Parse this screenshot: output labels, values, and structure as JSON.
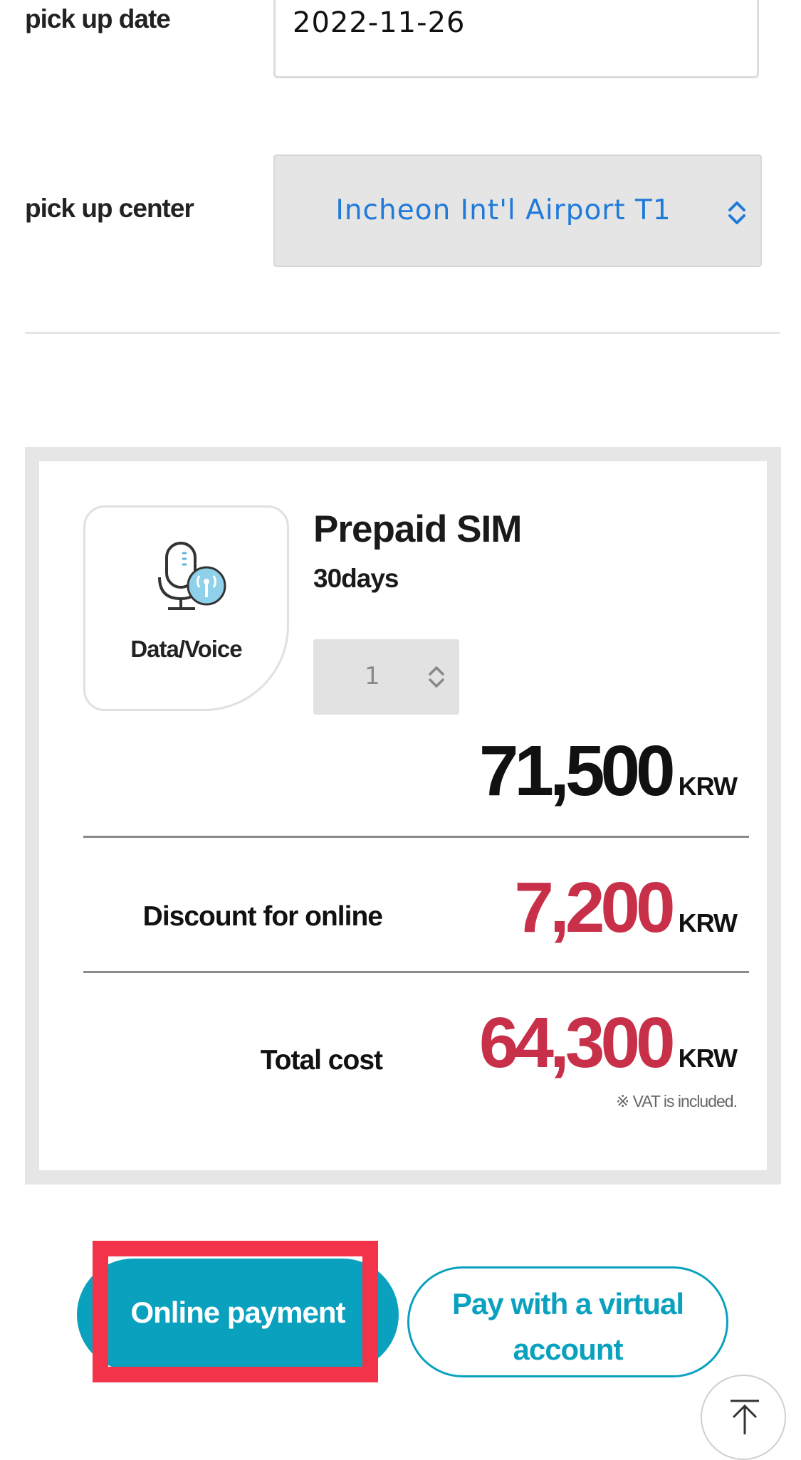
{
  "pickup_date": {
    "label": "pick up date",
    "value": "2022-11-26"
  },
  "pickup_center": {
    "label": "pick up center",
    "selected": "Incheon Int'l Airport T1"
  },
  "product": {
    "category_label": "Data/Voice",
    "category_icon": "microphone-signal-icon",
    "name": "Prepaid SIM",
    "duration": "30days",
    "quantity": "1"
  },
  "pricing": {
    "base_amount": "71,500",
    "base_unit": "KRW",
    "discount_label": "Discount for online",
    "discount_amount": "7,200",
    "discount_unit": "KRW",
    "total_label": "Total cost",
    "total_amount": "64,300",
    "total_unit": "KRW",
    "vat_note": "※ VAT is included."
  },
  "actions": {
    "online_payment_label": "Online payment",
    "virtual_account_label": "Pay with a virtual account"
  },
  "colors": {
    "accent": "#0aa1bf",
    "price_red": "#c8304a",
    "highlight": "#f3334a",
    "select_text": "#1f7ad8"
  }
}
